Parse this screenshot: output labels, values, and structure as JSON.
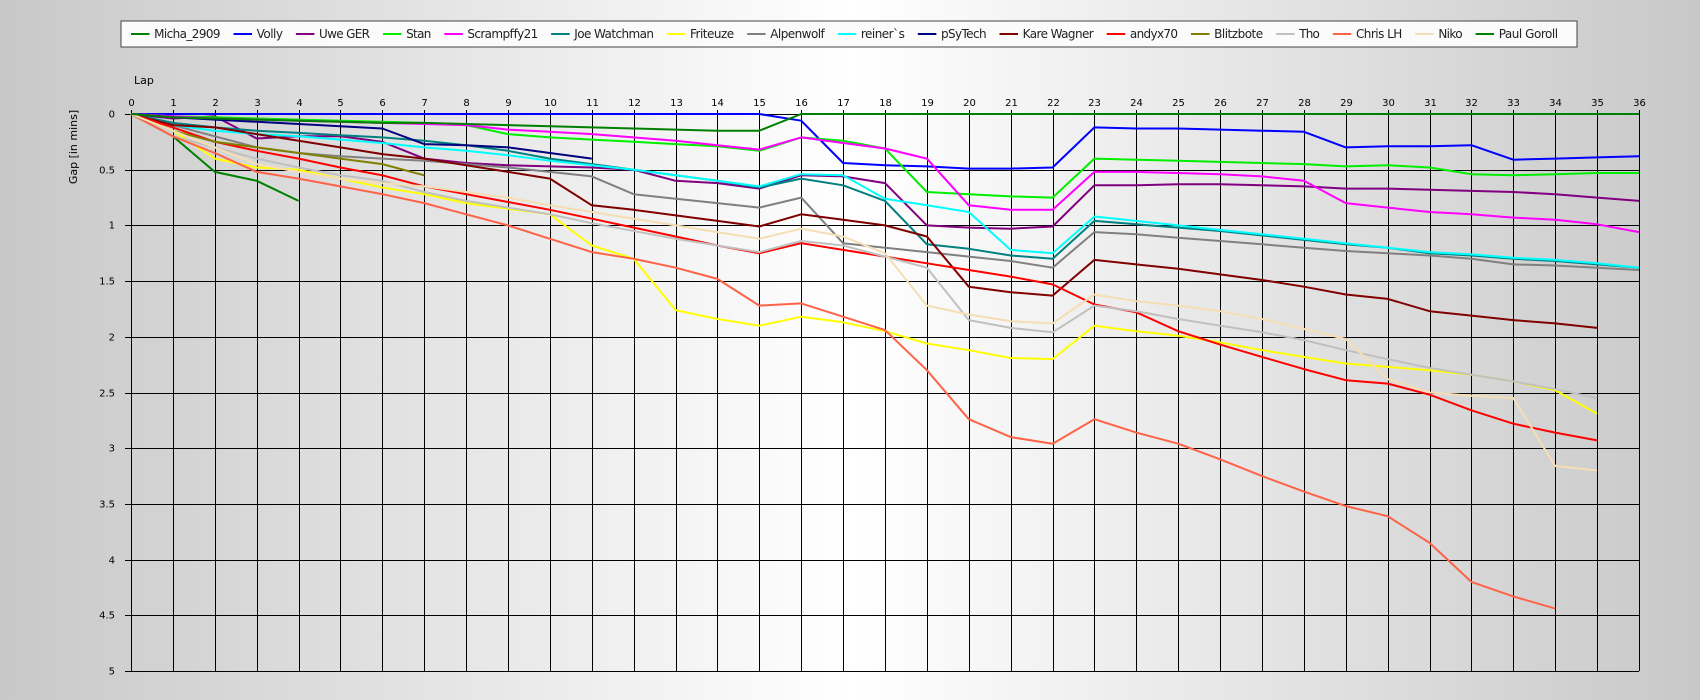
{
  "chart_data": {
    "type": "line",
    "xlabel": "Lap",
    "ylabel": "Gap [in mins]",
    "xlim": [
      0,
      36
    ],
    "ylim": [
      0,
      5
    ],
    "y_inverted": true,
    "grid": true,
    "legend_position": "top",
    "x_ticks": [
      "0",
      "1",
      "2",
      "3",
      "4",
      "5",
      "6",
      "7",
      "8",
      "9",
      "10",
      "11",
      "12",
      "13",
      "14",
      "15",
      "16",
      "17",
      "18",
      "19",
      "20",
      "21",
      "22",
      "23",
      "24",
      "25",
      "26",
      "27",
      "28",
      "29",
      "30",
      "31",
      "32",
      "33",
      "34",
      "35",
      "36"
    ],
    "y_ticks": [
      "0",
      "0.5",
      "1",
      "1.5",
      "2",
      "2.5",
      "3",
      "3.5",
      "4",
      "4.5",
      "5"
    ],
    "series": [
      {
        "name": "Micha_2909",
        "color": "#008000",
        "x": [
          0,
          1,
          2,
          3,
          4
        ],
        "y": [
          0,
          0.2,
          0.52,
          0.6,
          0.78
        ]
      },
      {
        "name": "Volly",
        "color": "#0000ff",
        "x": [
          0,
          1,
          2,
          3,
          4,
          5,
          6,
          7,
          8,
          9,
          10,
          11,
          12,
          13,
          14,
          15,
          16,
          17,
          18,
          19,
          20,
          21,
          22,
          23,
          24,
          25,
          26,
          27,
          28,
          29,
          30,
          31,
          32,
          33,
          34,
          35,
          36
        ],
        "y": [
          0,
          0,
          0,
          0,
          0,
          0,
          0,
          0,
          0,
          0,
          0,
          0,
          0,
          0,
          0,
          0,
          0.06,
          0.44,
          0.46,
          0.47,
          0.49,
          0.49,
          0.48,
          0.12,
          0.13,
          0.13,
          0.14,
          0.15,
          0.16,
          0.3,
          0.29,
          0.29,
          0.28,
          0.41,
          0.4,
          0.39,
          0.38
        ]
      },
      {
        "name": "Uwe GER",
        "color": "#800080",
        "x": [
          0,
          1,
          2,
          3,
          4,
          5,
          6,
          7,
          8,
          9,
          10,
          11,
          12,
          13,
          14,
          15,
          16,
          17,
          18,
          19,
          20,
          21,
          22,
          23,
          24,
          25,
          26,
          27,
          28,
          29,
          30,
          31,
          32,
          33,
          34,
          35,
          36
        ],
        "y": [
          0,
          0.04,
          0.02,
          0.22,
          0.2,
          0.2,
          0.25,
          0.4,
          0.44,
          0.46,
          0.47,
          0.48,
          0.5,
          0.6,
          0.62,
          0.67,
          0.55,
          0.56,
          0.62,
          1.0,
          1.02,
          1.03,
          1.01,
          0.64,
          0.64,
          0.63,
          0.63,
          0.64,
          0.65,
          0.67,
          0.67,
          0.68,
          0.69,
          0.7,
          0.72,
          0.75,
          0.78
        ]
      },
      {
        "name": "Stan",
        "color": "#00ee00",
        "x": [
          0,
          1,
          2,
          3,
          4,
          5,
          6,
          7,
          8,
          9,
          10,
          11,
          12,
          13,
          14,
          15,
          16,
          17,
          18,
          19,
          20,
          21,
          22,
          23,
          24,
          25,
          26,
          27,
          28,
          29,
          30,
          31,
          32,
          33,
          34,
          35,
          36
        ],
        "y": [
          0,
          0.02,
          0.03,
          0.04,
          0.05,
          0.06,
          0.07,
          0.08,
          0.1,
          0.18,
          0.21,
          0.23,
          0.25,
          0.27,
          0.29,
          0.33,
          0.21,
          0.24,
          0.31,
          0.7,
          0.72,
          0.74,
          0.75,
          0.4,
          0.41,
          0.42,
          0.43,
          0.44,
          0.45,
          0.47,
          0.46,
          0.48,
          0.54,
          0.55,
          0.54,
          0.53,
          0.53
        ]
      },
      {
        "name": "Scrampffy21",
        "color": "#ff00ff",
        "x": [
          0,
          1,
          2,
          3,
          4,
          5,
          6,
          7,
          8,
          9,
          10,
          11,
          12,
          13,
          14,
          15,
          16,
          17,
          18,
          19,
          20,
          21,
          22,
          23,
          24,
          25,
          26,
          27,
          28,
          29,
          30,
          31,
          32,
          33,
          34,
          35,
          36
        ],
        "y": [
          0,
          0.02,
          0.04,
          0.05,
          0.06,
          0.07,
          0.08,
          0.09,
          0.1,
          0.14,
          0.16,
          0.18,
          0.21,
          0.24,
          0.28,
          0.32,
          0.21,
          0.26,
          0.31,
          0.4,
          0.82,
          0.86,
          0.86,
          0.52,
          0.52,
          0.53,
          0.54,
          0.56,
          0.6,
          0.8,
          0.84,
          0.88,
          0.9,
          0.93,
          0.95,
          0.99,
          1.06
        ]
      },
      {
        "name": "Joe Watchman",
        "color": "#008080",
        "x": [
          0,
          1,
          2,
          3,
          4,
          5,
          6,
          7,
          8,
          9,
          10,
          11,
          12,
          13,
          14,
          15,
          16,
          17,
          18,
          19,
          20,
          21,
          22,
          23,
          24,
          25,
          26,
          27,
          28,
          29,
          30,
          31,
          32,
          33,
          34,
          35,
          36
        ],
        "y": [
          0,
          0.08,
          0.12,
          0.15,
          0.17,
          0.19,
          0.21,
          0.24,
          0.28,
          0.33,
          0.4,
          0.45,
          0.5,
          0.55,
          0.6,
          0.66,
          0.58,
          0.64,
          0.78,
          1.17,
          1.21,
          1.27,
          1.3,
          0.96,
          0.99,
          1.02,
          1.05,
          1.09,
          1.13,
          1.17,
          1.2,
          1.25,
          1.27,
          1.3,
          1.32,
          1.35,
          1.38
        ]
      },
      {
        "name": "Friteuze",
        "color": "#ffff00",
        "x": [
          0,
          1,
          2,
          3,
          4,
          5,
          6,
          7,
          8,
          9,
          10,
          11,
          12,
          13,
          14,
          15,
          16,
          17,
          18,
          19,
          20,
          21,
          22,
          23,
          24,
          25,
          26,
          27,
          28,
          29,
          30,
          31,
          32,
          33,
          34,
          35
        ],
        "y": [
          0,
          0.15,
          0.4,
          0.48,
          0.5,
          0.58,
          0.66,
          0.72,
          0.8,
          0.85,
          0.9,
          1.18,
          1.3,
          1.76,
          1.84,
          1.9,
          1.82,
          1.87,
          1.95,
          2.06,
          2.12,
          2.19,
          2.2,
          1.9,
          1.95,
          1.99,
          2.05,
          2.12,
          2.18,
          2.24,
          2.27,
          2.3,
          2.34,
          2.4,
          2.48,
          2.69
        ]
      },
      {
        "name": "Alpenwolf",
        "color": "#808080",
        "x": [
          0,
          1,
          2,
          3,
          4,
          5,
          6,
          7,
          8,
          9,
          10,
          11,
          12,
          13,
          14,
          15,
          16,
          17,
          18,
          19,
          20,
          21,
          22,
          23,
          24,
          25,
          26,
          27,
          28,
          29,
          30,
          31,
          32,
          33,
          34,
          35,
          36
        ],
        "y": [
          0,
          0.1,
          0.2,
          0.3,
          0.35,
          0.38,
          0.4,
          0.42,
          0.45,
          0.48,
          0.52,
          0.56,
          0.72,
          0.76,
          0.8,
          0.84,
          0.75,
          1.16,
          1.2,
          1.24,
          1.28,
          1.32,
          1.38,
          1.06,
          1.08,
          1.11,
          1.14,
          1.17,
          1.2,
          1.23,
          1.25,
          1.27,
          1.3,
          1.35,
          1.36,
          1.38,
          1.4
        ]
      },
      {
        "name": "reiner`s",
        "color": "#00ffff",
        "x": [
          0,
          1,
          2,
          3,
          4,
          5,
          6,
          7,
          8,
          9,
          10,
          11,
          12,
          13,
          14,
          15,
          16,
          17,
          18,
          19,
          20,
          21,
          22,
          23,
          24,
          25,
          26,
          27,
          28,
          29,
          30,
          31,
          32,
          33,
          34,
          35,
          36
        ],
        "y": [
          0,
          0.1,
          0.15,
          0.18,
          0.2,
          0.23,
          0.26,
          0.3,
          0.33,
          0.37,
          0.42,
          0.46,
          0.5,
          0.55,
          0.6,
          0.65,
          0.54,
          0.55,
          0.76,
          0.82,
          0.88,
          1.22,
          1.25,
          0.92,
          0.96,
          1.0,
          1.04,
          1.08,
          1.12,
          1.16,
          1.2,
          1.24,
          1.26,
          1.29,
          1.31,
          1.34,
          1.38
        ]
      },
      {
        "name": "pSyTech",
        "color": "#000080",
        "x": [
          0,
          1,
          2,
          3,
          4,
          5,
          6,
          7,
          8,
          9,
          10,
          11
        ],
        "y": [
          0,
          0.03,
          0.05,
          0.07,
          0.09,
          0.11,
          0.13,
          0.27,
          0.28,
          0.3,
          0.35,
          0.4
        ]
      },
      {
        "name": "Kare Wagner",
        "color": "#800000",
        "x": [
          0,
          1,
          2,
          3,
          4,
          5,
          6,
          7,
          8,
          9,
          10,
          11,
          12,
          13,
          14,
          15,
          16,
          17,
          18,
          19,
          20,
          21,
          22,
          23,
          24,
          25,
          26,
          27,
          28,
          29,
          30,
          31,
          32,
          33,
          34,
          35
        ],
        "y": [
          0,
          0.1,
          0.12,
          0.18,
          0.24,
          0.3,
          0.36,
          0.4,
          0.46,
          0.52,
          0.58,
          0.82,
          0.86,
          0.91,
          0.96,
          1.01,
          0.9,
          0.95,
          1.0,
          1.1,
          1.55,
          1.6,
          1.63,
          1.31,
          1.35,
          1.39,
          1.44,
          1.49,
          1.55,
          1.62,
          1.66,
          1.77,
          1.81,
          1.85,
          1.88,
          1.92
        ]
      },
      {
        "name": "andyx70",
        "color": "#ff0000",
        "x": [
          0,
          1,
          2,
          3,
          4,
          5,
          6,
          7,
          8,
          9,
          10,
          11,
          12,
          13,
          14,
          15,
          16,
          17,
          18,
          19,
          20,
          21,
          22,
          23,
          24,
          25,
          26,
          27,
          28,
          29,
          30,
          31,
          32,
          33,
          34,
          35
        ],
        "y": [
          0,
          0.12,
          0.25,
          0.33,
          0.4,
          0.48,
          0.55,
          0.65,
          0.72,
          0.79,
          0.86,
          0.94,
          1.02,
          1.1,
          1.18,
          1.25,
          1.16,
          1.22,
          1.28,
          1.34,
          1.4,
          1.46,
          1.53,
          1.71,
          1.78,
          1.95,
          2.07,
          2.18,
          2.29,
          2.39,
          2.42,
          2.52,
          2.66,
          2.78,
          2.86,
          2.93
        ]
      },
      {
        "name": "Blitzbote",
        "color": "#808000",
        "x": [
          0,
          1,
          2,
          3,
          4,
          5,
          6,
          7
        ],
        "y": [
          0,
          0.15,
          0.25,
          0.3,
          0.35,
          0.4,
          0.45,
          0.55
        ]
      },
      {
        "name": "Tho",
        "color": "#c0c0c0",
        "x": [
          0,
          1,
          2,
          3,
          4,
          5,
          6,
          7,
          8,
          9,
          10,
          11,
          12,
          13,
          14,
          15,
          16,
          17,
          18,
          19,
          20,
          21,
          22,
          23,
          24,
          25,
          26,
          27,
          28,
          29,
          30,
          31,
          32,
          33,
          34,
          35
        ],
        "y": [
          0,
          0.2,
          0.3,
          0.4,
          0.48,
          0.55,
          0.6,
          0.7,
          0.78,
          0.84,
          0.9,
          0.98,
          1.05,
          1.12,
          1.18,
          1.24,
          1.14,
          1.18,
          1.28,
          1.38,
          1.85,
          1.92,
          1.96,
          1.72,
          1.77,
          1.84,
          1.9,
          1.96,
          2.03,
          2.12,
          2.2,
          2.28,
          2.34,
          2.4,
          2.47,
          2.55
        ]
      },
      {
        "name": "Chris LH",
        "color": "#ff6347",
        "x": [
          0,
          1,
          2,
          3,
          4,
          5,
          6,
          7,
          8,
          9,
          10,
          11,
          12,
          13,
          14,
          15,
          16,
          17,
          18,
          19,
          20,
          21,
          22,
          23,
          24,
          25,
          26,
          27,
          28,
          29,
          30,
          31,
          32,
          33,
          34
        ],
        "y": [
          0,
          0.2,
          0.35,
          0.52,
          0.58,
          0.65,
          0.72,
          0.8,
          0.9,
          1.0,
          1.12,
          1.24,
          1.3,
          1.38,
          1.48,
          1.72,
          1.7,
          1.82,
          1.94,
          2.3,
          2.74,
          2.9,
          2.96,
          2.74,
          2.86,
          2.96,
          3.1,
          3.25,
          3.39,
          3.52,
          3.61,
          3.85,
          4.2,
          4.33,
          4.44
        ]
      },
      {
        "name": "Niko",
        "color": "#f5deb3",
        "x": [
          0,
          1,
          2,
          3,
          4,
          5,
          6,
          7,
          8,
          9,
          10,
          11,
          12,
          13,
          14,
          15,
          16,
          17,
          18,
          19,
          20,
          21,
          22,
          23,
          24,
          25,
          26,
          27,
          28,
          29,
          30,
          31,
          32,
          33,
          34,
          35
        ],
        "y": [
          0,
          0.15,
          0.3,
          0.45,
          0.52,
          0.58,
          0.62,
          0.65,
          0.7,
          0.75,
          0.82,
          0.88,
          0.94,
          1.0,
          1.06,
          1.12,
          1.03,
          1.1,
          1.25,
          1.72,
          1.8,
          1.86,
          1.88,
          1.62,
          1.68,
          1.72,
          1.77,
          1.84,
          1.93,
          2.02,
          2.38,
          2.5,
          2.53,
          2.55,
          3.16,
          3.2
        ]
      },
      {
        "name": "Paul Goroll",
        "color": "#008000",
        "x": [
          0,
          1,
          2,
          3,
          4,
          5,
          6,
          7,
          8,
          9,
          10,
          11,
          12,
          13,
          14,
          15,
          16,
          17,
          18,
          19,
          20,
          21,
          22,
          23,
          24,
          25,
          26,
          27,
          28,
          29,
          30,
          31,
          32,
          33,
          34,
          35,
          36
        ],
        "y": [
          0,
          0.03,
          0.04,
          0.05,
          0.06,
          0.07,
          0.08,
          0.08,
          0.09,
          0.1,
          0.11,
          0.12,
          0.13,
          0.14,
          0.15,
          0.15,
          0,
          0,
          0,
          0,
          0,
          0,
          0,
          0,
          0,
          0,
          0,
          0,
          0,
          0,
          0,
          0,
          0,
          0,
          0,
          0,
          0
        ]
      }
    ]
  }
}
